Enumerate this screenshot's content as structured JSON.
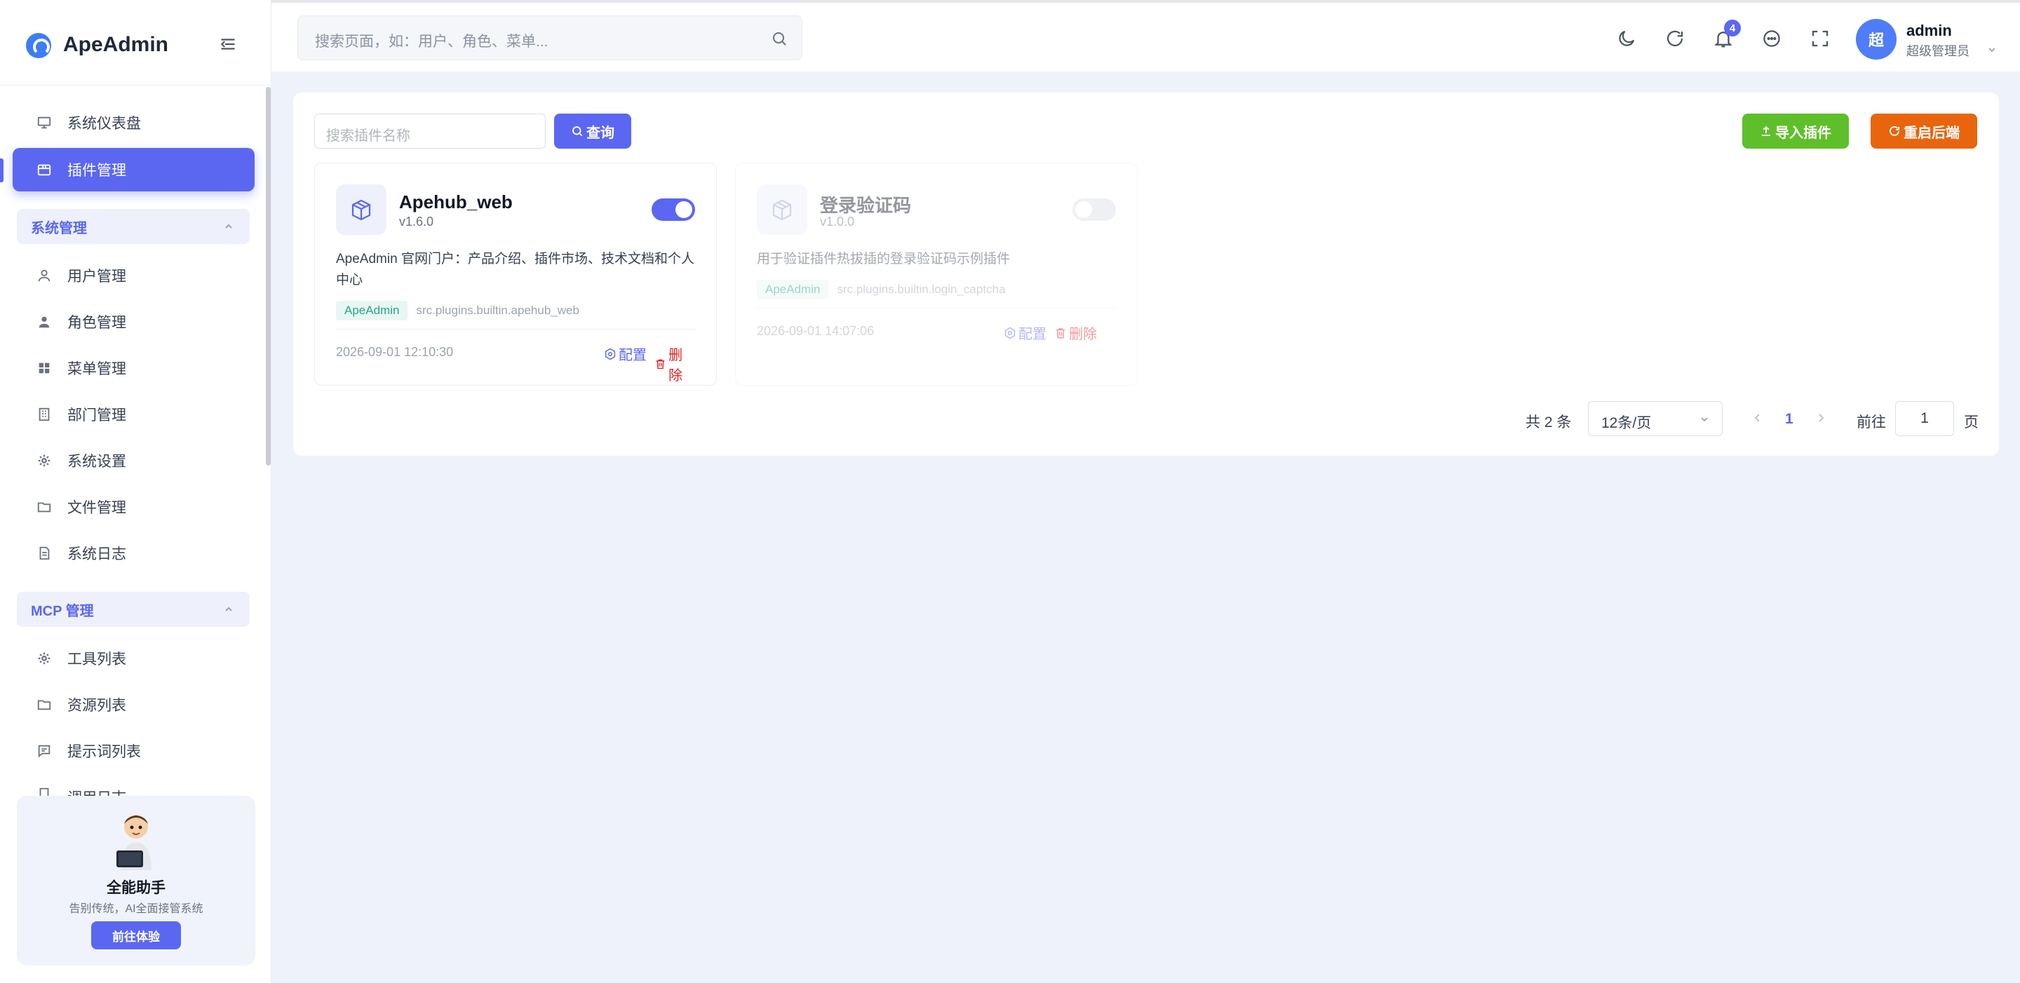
{
  "app": {
    "name": "ApeAdmin"
  },
  "sidebar": {
    "top_items": [
      {
        "label": "系统仪表盘",
        "icon": "monitor-icon"
      },
      {
        "label": "插件管理",
        "icon": "package-icon",
        "active": true
      }
    ],
    "groups": [
      {
        "label": "系统管理",
        "items": [
          {
            "label": "用户管理",
            "icon": "user-icon"
          },
          {
            "label": "角色管理",
            "icon": "user-filled-icon"
          },
          {
            "label": "菜单管理",
            "icon": "grid-icon"
          },
          {
            "label": "部门管理",
            "icon": "building-icon"
          },
          {
            "label": "系统设置",
            "icon": "gear-icon"
          },
          {
            "label": "文件管理",
            "icon": "folder-icon"
          },
          {
            "label": "系统日志",
            "icon": "document-icon"
          }
        ]
      },
      {
        "label": "MCP 管理",
        "items": [
          {
            "label": "工具列表",
            "icon": "gear-icon"
          },
          {
            "label": "资源列表",
            "icon": "folder-icon"
          },
          {
            "label": "提示词列表",
            "icon": "chat-icon"
          },
          {
            "label": "调用日志",
            "icon": "log-icon"
          }
        ]
      }
    ],
    "promo": {
      "title": "全能助手",
      "subtitle": "告别传统，AI全面接管系统",
      "button": "前往体验"
    }
  },
  "header": {
    "search_placeholder": "搜索页面，如：用户、角色、菜单...",
    "notification_count": "4",
    "user": {
      "avatar_text": "超",
      "name": "admin",
      "role": "超级管理员"
    }
  },
  "plugins_page": {
    "search_placeholder": "搜索插件名称",
    "query_button": "查询",
    "import_button": "导入插件",
    "restart_button": "重启后端",
    "plugins": [
      {
        "name": "Apehub_web",
        "version": "v1.6.0",
        "enabled": true,
        "description": "ApeAdmin 官网门户：产品介绍、插件市场、技术文档和个人中心",
        "tag": "ApeAdmin",
        "path": "src.plugins.builtin.apehub_web",
        "date": "2026-09-01 12:10:30",
        "config_label": "配置",
        "delete_label": "删除"
      },
      {
        "name": "登录验证码",
        "version": "v1.0.0",
        "enabled": false,
        "description": "用于验证插件热拔插的登录验证码示例插件",
        "tag": "ApeAdmin",
        "path": "src.plugins.builtin.login_captcha",
        "date": "2026-09-01 14:07:06",
        "config_label": "配置",
        "delete_label": "删除"
      }
    ],
    "pagination": {
      "total_text": "共 2 条",
      "page_size": "12条/页",
      "current_page": "1",
      "goto_label": "前往",
      "goto_value": "1",
      "page_unit": "页"
    }
  },
  "colors": {
    "primary": "#5b67f1",
    "success": "#5fbf2a",
    "warning": "#e8650e",
    "danger": "#e02424"
  }
}
